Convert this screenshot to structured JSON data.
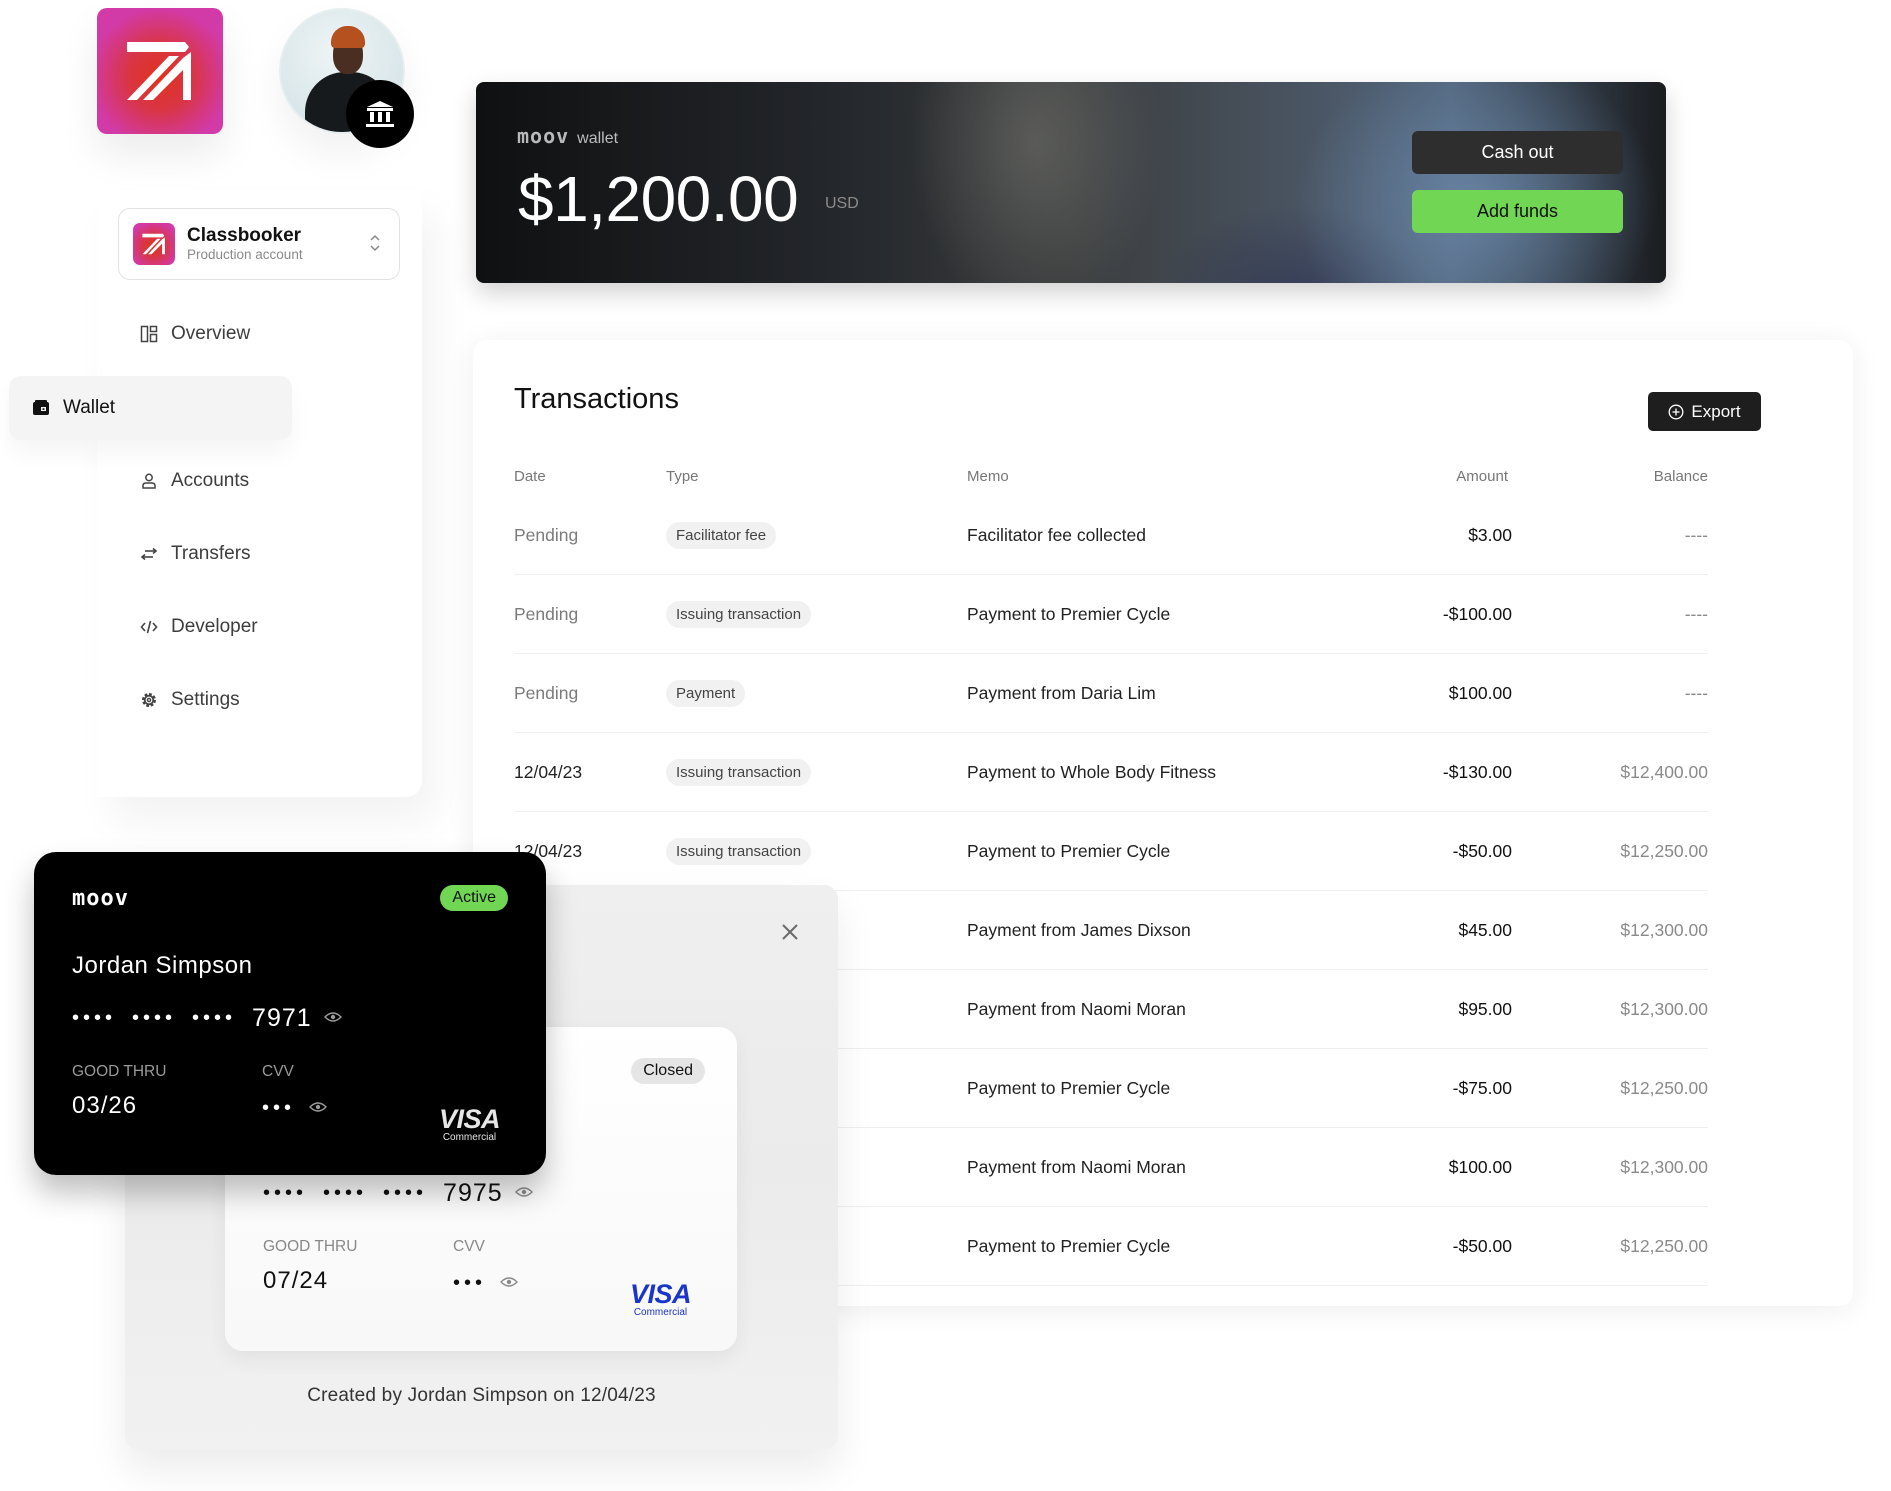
{
  "brand": {
    "logo_icon": "classbooker-logo-icon",
    "avatar_badge_icon": "bank-icon"
  },
  "account_switcher": {
    "name": "Classbooker",
    "subtitle": "Production account",
    "icon": "chevron-up-down-icon"
  },
  "sidebar": {
    "items": [
      {
        "label": "Overview",
        "icon": "layout-icon",
        "active": false
      },
      {
        "label": "Wallet",
        "icon": "wallet-icon",
        "active": true
      },
      {
        "label": "Accounts",
        "icon": "user-icon",
        "active": false
      },
      {
        "label": "Transfers",
        "icon": "transfer-arrows-icon",
        "active": false
      },
      {
        "label": "Developer",
        "icon": "code-icon",
        "active": false
      },
      {
        "label": "Settings",
        "icon": "gear-icon",
        "active": false
      }
    ]
  },
  "wallet": {
    "brand": "moov",
    "label": "wallet",
    "balance": "$1,200.00",
    "currency": "USD",
    "cash_out_label": "Cash out",
    "add_funds_label": "Add funds",
    "colors": {
      "add_funds": "#72d655",
      "cash_out": "#2e2e2e"
    }
  },
  "transactions": {
    "title": "Transactions",
    "export_label": "Export",
    "columns": [
      "Date",
      "Type",
      "Memo",
      "Amount",
      "Balance"
    ],
    "rows": [
      {
        "date": "Pending",
        "type": "Facilitator fee",
        "memo": "Facilitator fee collected",
        "amount": "$3.00",
        "balance": "----"
      },
      {
        "date": "Pending",
        "type": "Issuing transaction",
        "memo": "Payment to Premier Cycle",
        "amount": "-$100.00",
        "balance": "----"
      },
      {
        "date": "Pending",
        "type": "Payment",
        "memo": "Payment from Daria Lim",
        "amount": "$100.00",
        "balance": "----"
      },
      {
        "date": "12/04/23",
        "type": "Issuing transaction",
        "memo": "Payment to Whole Body Fitness",
        "amount": "-$130.00",
        "balance": "$12,400.00"
      },
      {
        "date": "12/04/23",
        "type": "Issuing transaction",
        "memo": "Payment to Premier Cycle",
        "amount": "-$50.00",
        "balance": "$12,250.00"
      },
      {
        "date": "",
        "type": "",
        "memo": "Payment from James Dixson",
        "amount": "$45.00",
        "balance": "$12,300.00"
      },
      {
        "date": "",
        "type": "",
        "memo": "Payment from Naomi Moran",
        "amount": "$95.00",
        "balance": "$12,300.00"
      },
      {
        "date": "",
        "type": "",
        "memo": "Payment to Premier Cycle",
        "amount": "-$75.00",
        "balance": "$12,250.00"
      },
      {
        "date": "",
        "type": "",
        "memo": "Payment from Naomi Moran",
        "amount": "$100.00",
        "balance": "$12,300.00"
      },
      {
        "date": "",
        "type": "",
        "memo": "Payment to Premier Cycle",
        "amount": "-$50.00",
        "balance": "$12,250.00"
      }
    ]
  },
  "cards": {
    "active": {
      "brand": "moov",
      "status": "Active",
      "holder": "Jordan Simpson",
      "masked_groups": [
        "••••",
        "••••",
        "••••"
      ],
      "last4": "7971",
      "good_thru_label": "GOOD THRU",
      "good_thru": "03/26",
      "cvv_label": "CVV",
      "cvv_masked": "•••",
      "network": "VISA",
      "network_tier": "Commercial",
      "status_color": "#72d655"
    },
    "closed": {
      "status": "Closed",
      "masked_groups": [
        "••••",
        "••••",
        "••••"
      ],
      "last4": "7975",
      "good_thru_label": "GOOD THRU",
      "good_thru": "07/24",
      "cvv_label": "CVV",
      "cvv_masked": "•••",
      "network": "VISA",
      "network_tier": "Commercial",
      "network_color": "#1a35c9"
    },
    "created_note": "Created by Jordan Simpson on 12/04/23"
  }
}
